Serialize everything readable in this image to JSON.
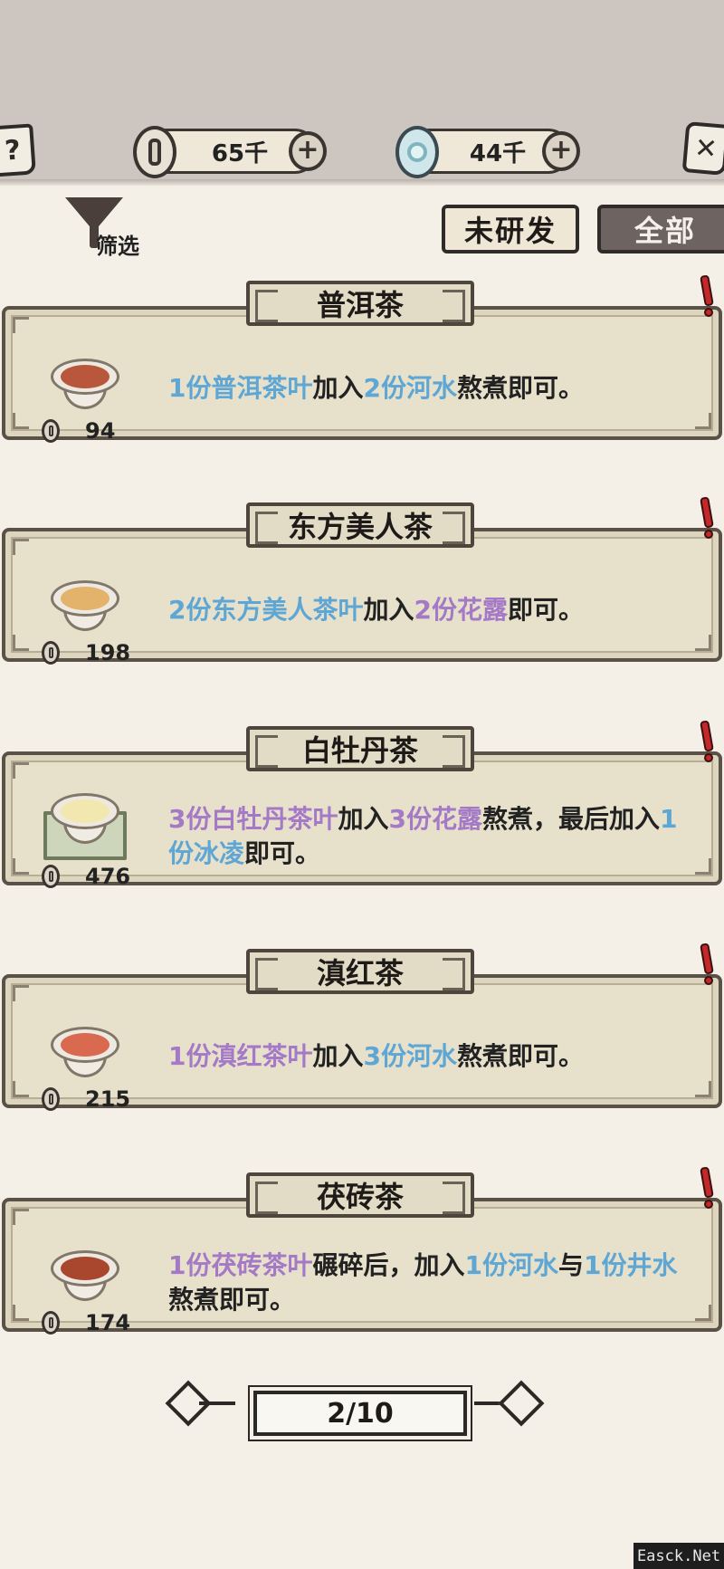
{
  "header": {
    "help_icon": "?",
    "close_icon": "✕",
    "coins": "65千",
    "jade": "44千",
    "plus": "+"
  },
  "filter": {
    "label": "筛选"
  },
  "tabs": {
    "undeveloped": "未研发",
    "all": "全部"
  },
  "recipes": [
    {
      "name": "普洱茶",
      "price": "94",
      "tea_color": "#b8573c",
      "segments": [
        {
          "t": "1份普洱茶叶",
          "c": "blue"
        },
        {
          "t": "加入",
          "c": ""
        },
        {
          "t": "2份河水",
          "c": "blue"
        },
        {
          "t": "熬煮即可。",
          "c": ""
        }
      ]
    },
    {
      "name": "东方美人茶",
      "price": "198",
      "tea_color": "#e3b26b",
      "segments": [
        {
          "t": "2份东方美人茶叶",
          "c": "blue"
        },
        {
          "t": "加入",
          "c": ""
        },
        {
          "t": "2份花露",
          "c": "purple"
        },
        {
          "t": "即可。",
          "c": ""
        }
      ]
    },
    {
      "name": "白牡丹茶",
      "price": "476",
      "tea_color": "#f3e7b0",
      "segments": [
        {
          "t": "3份白牡丹茶叶",
          "c": "purple"
        },
        {
          "t": "加入",
          "c": ""
        },
        {
          "t": "3份花露",
          "c": "purple"
        },
        {
          "t": "熬煮，最后加入",
          "c": ""
        },
        {
          "t": "1份冰凌",
          "c": "blue"
        },
        {
          "t": "即可。",
          "c": ""
        }
      ]
    },
    {
      "name": "滇红茶",
      "price": "215",
      "tea_color": "#d9694f",
      "segments": [
        {
          "t": "1份滇红茶叶",
          "c": "purple"
        },
        {
          "t": "加入",
          "c": ""
        },
        {
          "t": "3份河水",
          "c": "blue"
        },
        {
          "t": "熬煮即可。",
          "c": ""
        }
      ]
    },
    {
      "name": "茯砖茶",
      "price": "174",
      "tea_color": "#a9472e",
      "segments": [
        {
          "t": "1份茯砖茶叶",
          "c": "purple"
        },
        {
          "t": "碾碎后，加入",
          "c": ""
        },
        {
          "t": "1份河水",
          "c": "blue"
        },
        {
          "t": "与",
          "c": ""
        },
        {
          "t": "1份井水",
          "c": "blue"
        },
        {
          "t": "熬煮即可。",
          "c": ""
        }
      ]
    }
  ],
  "pager": {
    "label": "2/10"
  },
  "watermark": "Easck.Net"
}
